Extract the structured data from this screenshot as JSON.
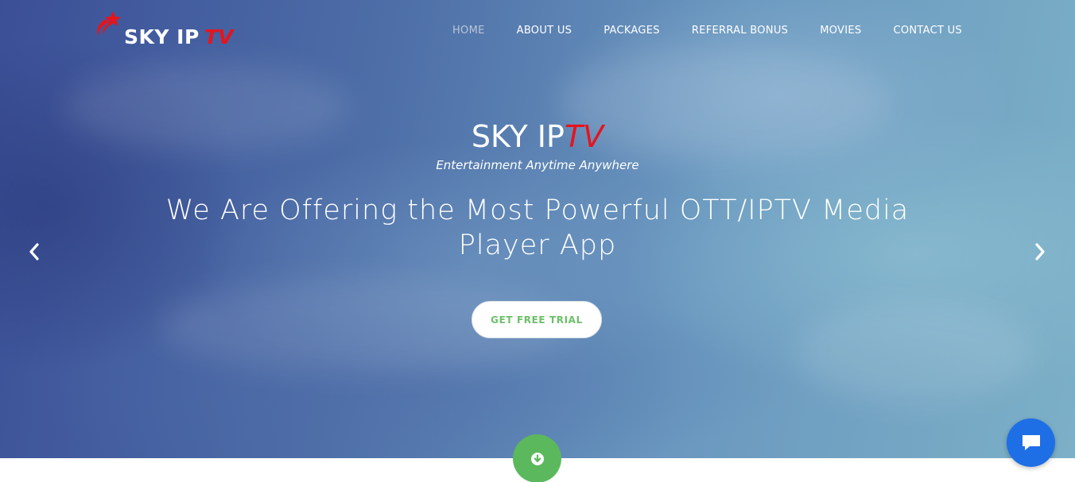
{
  "header": {
    "logo": {
      "text": "SKY IP",
      "accent": "TV",
      "icon": "red-star-swoosh-icon"
    },
    "nav": [
      {
        "label": "HOME",
        "active": true
      },
      {
        "label": "ABOUT US",
        "active": false
      },
      {
        "label": "PACKAGES",
        "active": false
      },
      {
        "label": "REFERRAL BONUS",
        "active": false
      },
      {
        "label": "MOVIES",
        "active": false
      },
      {
        "label": "CONTACT US",
        "active": false
      }
    ]
  },
  "hero": {
    "brand": "SKY IP",
    "brand_accent": "TV",
    "tagline": "Entertainment Anytime Anywhere",
    "headline_line1": "We Are Offering the Most Powerful OTT/IPTV Media",
    "headline_line2": "Player App",
    "cta_label": "GET FREE TRIAL",
    "prev_icon": "chevron-left-icon",
    "next_icon": "chevron-right-icon"
  },
  "floating": {
    "scroll_icon": "arrow-down-circle-icon",
    "chat_icon": "chat-bubble-icon"
  },
  "colors": {
    "accent_red": "#e6141c",
    "cta_text_green": "#6cc069",
    "scroll_green": "#5cb85c",
    "chat_blue": "#1e6fe6",
    "nav_active": "#b8c6d6"
  }
}
